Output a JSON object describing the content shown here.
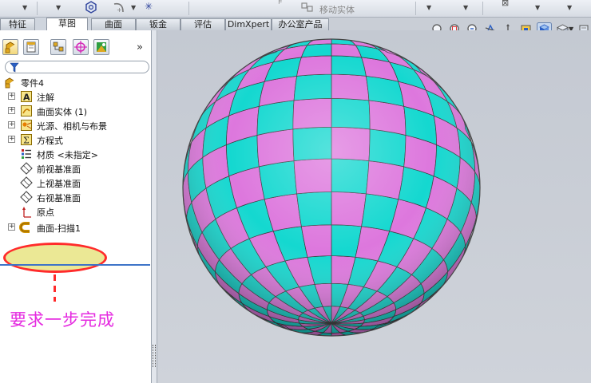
{
  "toolbar": {
    "move_body_label": "移动实体"
  },
  "tabs": [
    {
      "label": "特征",
      "active": false
    },
    {
      "label": "草图",
      "active": true
    },
    {
      "label": "曲面",
      "active": false
    },
    {
      "label": "钣金",
      "active": false
    },
    {
      "label": "评估",
      "active": false
    },
    {
      "label": "DimXpert",
      "active": false
    },
    {
      "label": "办公室产品",
      "active": false
    }
  ],
  "panel": {
    "tabs": [
      "feature-manager",
      "property-manager",
      "configuration-manager",
      "dimxpert-manager",
      "display-manager"
    ],
    "expand_label": "»",
    "filter_icon": "funnel"
  },
  "tree": {
    "root": {
      "label": "零件4",
      "icon": "part-icon"
    },
    "items": [
      {
        "label": "注解",
        "icon": "annotation-icon",
        "expandable": true
      },
      {
        "label": "曲面实体 (1)",
        "icon": "surface-body-icon",
        "expandable": true
      },
      {
        "label": "光源、相机与布景",
        "icon": "lights-icon",
        "expandable": true
      },
      {
        "label": "方程式",
        "icon": "equation-icon",
        "expandable": true
      },
      {
        "label": "材质 <未指定>",
        "icon": "material-icon",
        "expandable": false
      },
      {
        "label": "前视基准面",
        "icon": "plane-icon",
        "expandable": false
      },
      {
        "label": "上视基准面",
        "icon": "plane-icon",
        "expandable": false
      },
      {
        "label": "右视基准面",
        "icon": "plane-icon",
        "expandable": false
      },
      {
        "label": "原点",
        "icon": "origin-icon",
        "expandable": false
      },
      {
        "label": "曲面-扫描1",
        "icon": "sweep-icon",
        "expandable": true,
        "selected": true
      }
    ]
  },
  "annotation": {
    "note": "要求一步完成"
  },
  "viewport": {
    "model": "sphere",
    "colors": {
      "pink": "#dd77dd",
      "cyan": "#14d8d0",
      "background": "#c9ced6"
    }
  },
  "colors": {
    "highlight_red": "#ff2b2b",
    "note_magenta": "#e52ae0",
    "selection_yellow": "#e8e482"
  }
}
